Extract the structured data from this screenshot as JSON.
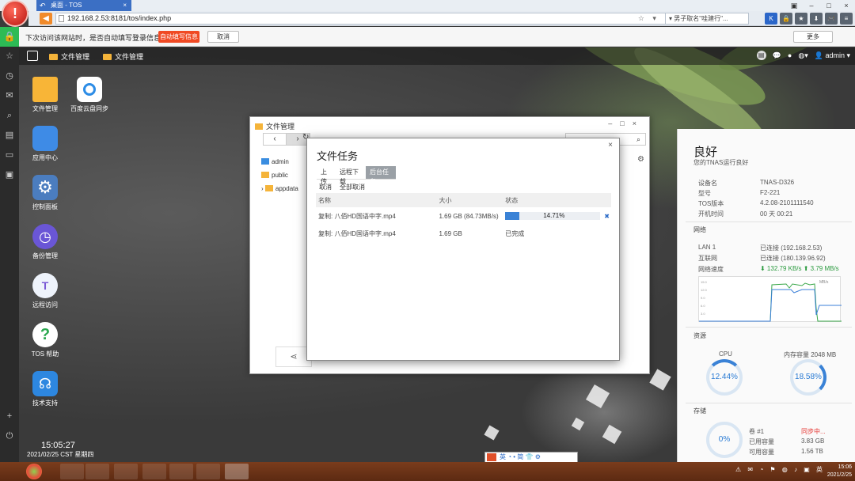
{
  "browser": {
    "logo": "!",
    "tab_title": "桌面 - TOS",
    "tab_close": "×",
    "back_icon": "↶",
    "win_controls": [
      "▣",
      "–",
      "□",
      "×"
    ],
    "url": "192.168.2.53:8181/tos/index.php",
    "url_icons": "☆ ▾ ↻",
    "search_text": "▾ 男子取名\"哇建行\"...",
    "extensions": [
      "K",
      "🔒",
      "★",
      "⬇",
      "🎮",
      "≡"
    ]
  },
  "password_bar": {
    "message": "下次访问该网站时，是否自动填写登录信息？",
    "autofill_label": "自动填写信息",
    "cancel_label": "取消",
    "more_label": "更多"
  },
  "tos_topbar": {
    "links": [
      "文件管理",
      "文件管理"
    ],
    "user": "admin"
  },
  "left_dock": [
    "☆",
    "◷",
    "✉",
    "⌕",
    "▤",
    "▭",
    "▣",
    "+",
    "⏻"
  ],
  "desktop_apps": [
    {
      "label": "文件管理"
    },
    {
      "label": "百度云盘同步"
    },
    {
      "label": "应用中心"
    },
    {
      "label": "控制面板"
    },
    {
      "label": "备份管理"
    },
    {
      "label": "远程访问"
    },
    {
      "label": "TOS 帮助"
    },
    {
      "label": "技术支持"
    }
  ],
  "clock": {
    "time": "15:05:27",
    "date": "2021/02/25 CST 星期四"
  },
  "file_manager": {
    "title": "文件管理",
    "window_controls": "–□×",
    "tree": [
      "admin",
      "public",
      "appdata"
    ],
    "share_icon": "⋖"
  },
  "file_tasks": {
    "title": "文件任务",
    "close": "×",
    "tabs": [
      "上传",
      "远程下载",
      "后台任务"
    ],
    "actions": [
      "取消",
      "全部取消"
    ],
    "columns": [
      "名称",
      "大小",
      "状态"
    ],
    "rows": [
      {
        "name": "复制: 八佰HD国语中字.mp4",
        "size": "1.69 GB (84.73MB/s)",
        "status": "14.71%",
        "progress": 0.1471
      },
      {
        "name": "复制: 八佰HD国语中字.mp4",
        "size": "1.69 GB",
        "status": "已完成"
      }
    ]
  },
  "status_panel": {
    "headline": "良好",
    "subline": "您的TNAS运行良好",
    "device": [
      {
        "k": "设备名",
        "v": "TNAS-D326"
      },
      {
        "k": "型号",
        "v": "F2-221"
      },
      {
        "k": "TOS版本",
        "v": "4.2.08-2101111540"
      },
      {
        "k": "开机时间",
        "v": "00 天 00:21"
      }
    ],
    "network_title": "网络",
    "network": [
      {
        "k": "LAN 1",
        "v": "已连接 (192.168.2.53)"
      },
      {
        "k": "互联网",
        "v": "已连接 (180.139.96.92)"
      },
      {
        "k": "网络速度",
        "v": "⬇ 132.79 KB/s  ⬆ 3.79 MB/s"
      }
    ],
    "graph_unit": "MB/s",
    "graph_ticks": [
      "15.0",
      "12.0",
      "9.0",
      "6.0",
      "3.0"
    ],
    "resources_title": "资源",
    "cpu_label": "CPU",
    "cpu_value": "12.44%",
    "mem_label": "内存容量 2048 MB",
    "mem_value": "18.58%",
    "storage_title": "存储",
    "storage_gauge": "0%",
    "storage": [
      {
        "k": "卷 #1",
        "v": "同步中..."
      },
      {
        "k": "已用容量",
        "v": "3.83 GB"
      },
      {
        "k": "可用容量",
        "v": "1.56 TB"
      }
    ]
  },
  "ime": "英 ◔ • 简 👕 ⚙",
  "taskbar_clock": {
    "time": "15:06",
    "date": "2021/2/25"
  },
  "colors": {
    "accent": "#3a82d6",
    "danger": "#e0502a",
    "ok": "#2dbb55"
  }
}
